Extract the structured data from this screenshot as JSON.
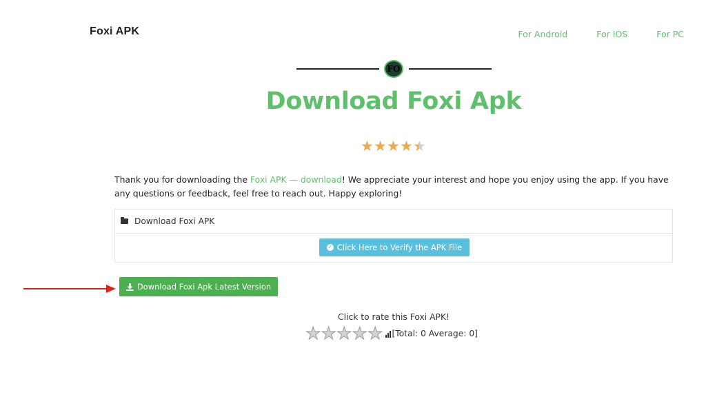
{
  "header": {
    "site_title": "Foxi APK",
    "nav": [
      "For Android",
      "For IOS",
      "For PC"
    ]
  },
  "divider": {
    "badge_text": "FO"
  },
  "main": {
    "title": "Download Foxi Apk",
    "rating_top": {
      "value": 4.5,
      "max": 5
    },
    "intro": {
      "before_link": "Thank you for downloading the ",
      "link_text": "Foxi APK — download",
      "after_link": "! We appreciate your interest and hope you enjoy using the app. If you have any questions or feedback, feel free to reach out. Happy exploring!"
    },
    "box": {
      "heading": "Download Foxi APK",
      "verify_button": "Click Here to Verify the APK File"
    },
    "download_button": "Download Foxi Apk Latest Version",
    "rate": {
      "prompt": "Click to rate this Foxi APK!",
      "stars": 5,
      "summary": "[Total: 0 Average: 0]"
    }
  },
  "colors": {
    "accent_green": "#5fc06c",
    "download_green": "#4caf50",
    "verify_blue": "#5bc0de",
    "star_orange": "#f0a94a",
    "arrow_red": "#e0221b"
  },
  "icons": {
    "badge": "logo-badge-icon",
    "folder": "folder-open-icon",
    "verify": "check-circle-icon",
    "download": "download-icon",
    "arrow": "red-arrow-icon",
    "stats": "bar-chart-icon"
  }
}
